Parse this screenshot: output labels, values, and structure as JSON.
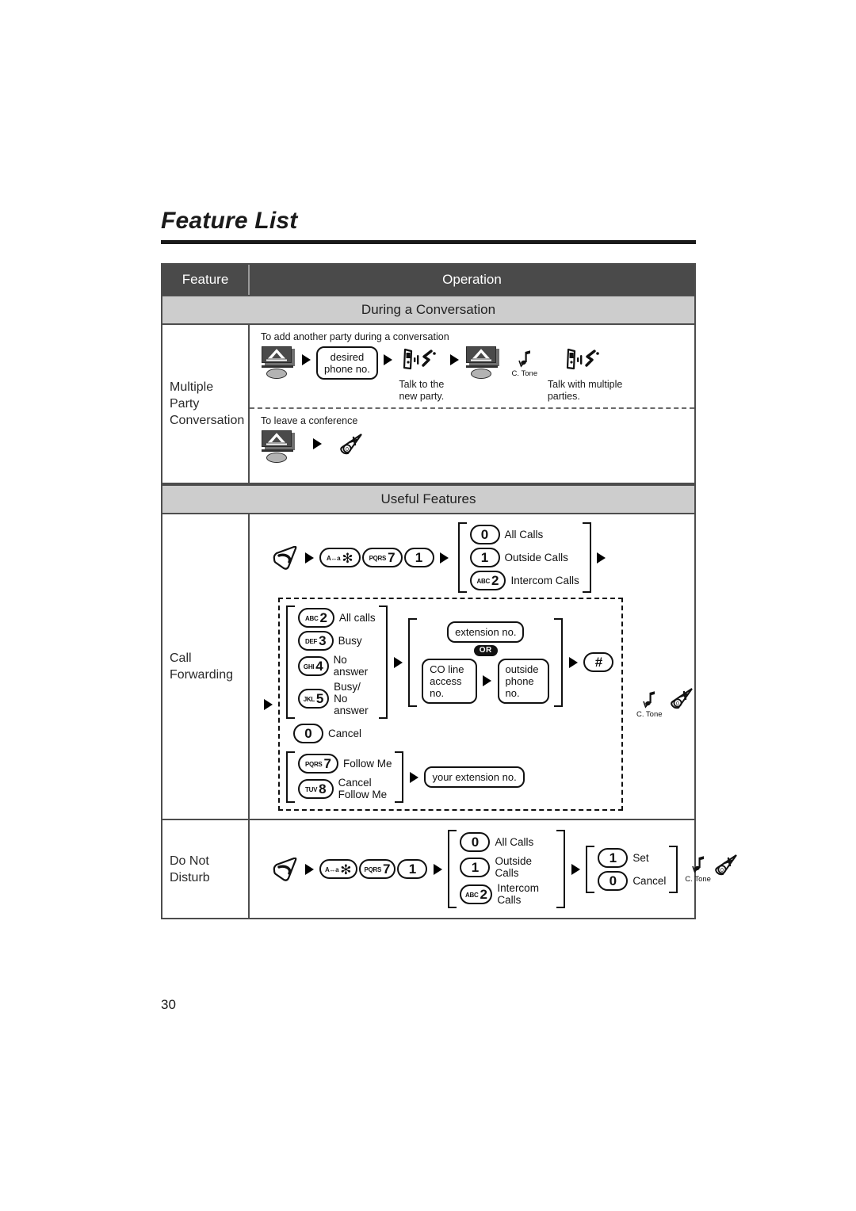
{
  "document": {
    "title": "Feature List",
    "page_number": "30"
  },
  "table": {
    "headers": {
      "feature": "Feature",
      "operation": "Operation"
    },
    "bands": {
      "during_conversation": "During a Conversation",
      "useful_features": "Useful Features"
    },
    "rows": {
      "multiple_party": {
        "feature": "Multiple\nParty\nConversation",
        "sub1": {
          "caption": "To add another party during a conversation",
          "box_desired_phone": "desired\nphone no.",
          "label_talk_new": "Talk to the\nnew party.",
          "tone_label": "C. Tone",
          "label_talk_multiple": "Talk with multiple\nparties."
        },
        "sub2": {
          "caption": "To leave a conference"
        }
      },
      "call_forwarding": {
        "feature": "Call\nForwarding",
        "keys": {
          "star": {
            "pre": "A↔a",
            "num": "✻"
          },
          "seven": {
            "pre": "PQRS",
            "num": "7"
          },
          "one": {
            "pre": "",
            "num": "1"
          },
          "hash": {
            "pre": "",
            "num": "#"
          }
        },
        "group1": [
          {
            "pre": "",
            "num": "0",
            "label": "All Calls"
          },
          {
            "pre": "",
            "num": "1",
            "label": "Outside Calls"
          },
          {
            "pre": "ABC",
            "num": "2",
            "label": "Intercom Calls"
          }
        ],
        "group2": [
          {
            "pre": "ABC",
            "num": "2",
            "label": "All calls"
          },
          {
            "pre": "DEF",
            "num": "3",
            "label": "Busy"
          },
          {
            "pre": "GHI",
            "num": "4",
            "label": "No answer"
          },
          {
            "pre": "JKL",
            "num": "5",
            "label": "Busy/\nNo answer"
          }
        ],
        "cancel_key": {
          "pre": "",
          "num": "0",
          "label": "Cancel"
        },
        "group3": [
          {
            "pre": "PQRS",
            "num": "7",
            "label": "Follow Me"
          },
          {
            "pre": "TUV",
            "num": "8",
            "label": "Cancel\nFollow Me"
          }
        ],
        "box_extension_no": "extension no.",
        "or_badge": "OR",
        "box_co_line": "CO line\naccess no.",
        "box_outside_phone": "outside\nphone no.",
        "box_your_extension": "your extension no.",
        "tone_label": "C. Tone"
      },
      "do_not_disturb": {
        "feature": "Do Not\nDisturb",
        "keys": {
          "star": {
            "pre": "A↔a",
            "num": "✻"
          },
          "seven": {
            "pre": "PQRS",
            "num": "7"
          },
          "one": {
            "pre": "",
            "num": "1"
          }
        },
        "group1": [
          {
            "pre": "",
            "num": "0",
            "label": "All Calls"
          },
          {
            "pre": "",
            "num": "1",
            "label": "Outside Calls"
          },
          {
            "pre": "ABC",
            "num": "2",
            "label": "Intercom Calls"
          }
        ],
        "group2": [
          {
            "pre": "",
            "num": "1",
            "label": "Set"
          },
          {
            "pre": "",
            "num": "0",
            "label": "Cancel"
          }
        ],
        "tone_label": "C. Tone"
      }
    }
  },
  "icons": {
    "flash_button": "flash-transfer-button-icon",
    "talk_button": "talk-handset-button-icon",
    "hangup_button": "hangup-power-off-button-icon",
    "talking_phone": "phone-talking-icon",
    "confirmation_tone": "confirmation-tone-icon",
    "arrow": "arrow-right-icon"
  },
  "colors": {
    "header_bg": "#4a4a4a",
    "band_bg": "#cdcdcd",
    "border": "#4d4d4d",
    "ink": "#111111"
  }
}
